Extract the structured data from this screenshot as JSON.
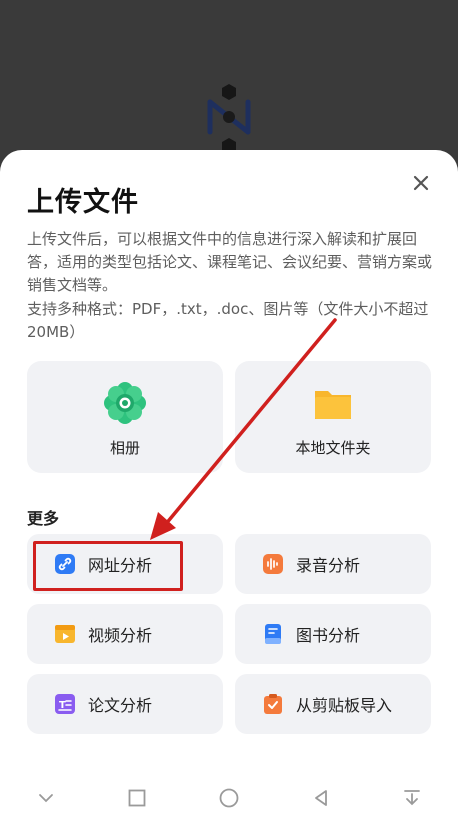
{
  "sheet": {
    "title": "上传文件",
    "description": "上传文件后，可以根据文件中的信息进行深入解读和扩展回答，适用的类型包括论文、课程笔记、会议纪要、营销方案或销售文档等。",
    "formats": "支持多种格式：PDF，.txt，.doc、图片等（文件大小不超过20MB）"
  },
  "sources": {
    "album": "相册",
    "local_folder": "本地文件夹"
  },
  "more": {
    "title": "更多",
    "items": [
      {
        "label": "网址分析",
        "icon": "link-icon"
      },
      {
        "label": "录音分析",
        "icon": "audio-icon"
      },
      {
        "label": "视频分析",
        "icon": "video-icon"
      },
      {
        "label": "图书分析",
        "icon": "book-icon"
      },
      {
        "label": "论文分析",
        "icon": "paper-icon"
      },
      {
        "label": "从剪贴板导入",
        "icon": "clipboard-icon"
      }
    ]
  },
  "colors": {
    "accent_red": "#d0201e",
    "card_bg": "#f1f2f5",
    "album_green": "#2ec27e",
    "folder_yellow": "#f8b62d"
  }
}
